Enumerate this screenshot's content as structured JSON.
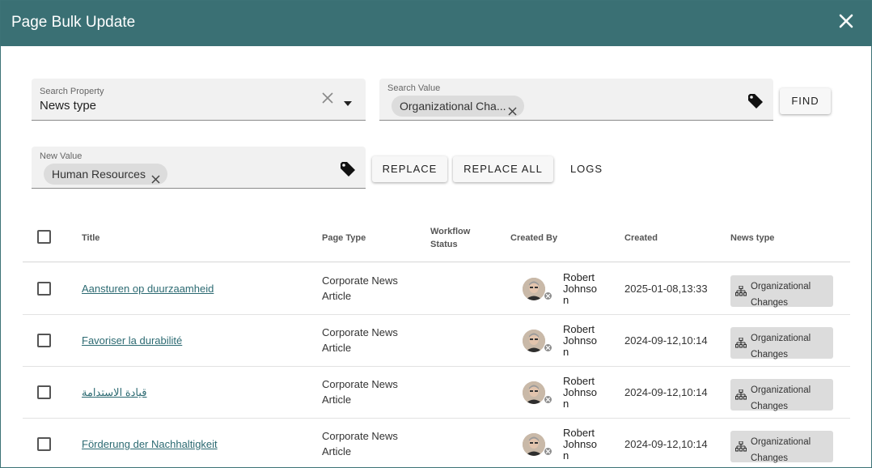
{
  "dialog": {
    "title": "Page Bulk Update",
    "close_icon": "close-icon"
  },
  "search_property": {
    "label": "Search Property",
    "value": "News type"
  },
  "search_value": {
    "label": "Search Value",
    "chip": "Organizational Cha..."
  },
  "new_value": {
    "label": "New Value",
    "chip": "Human Resources"
  },
  "buttons": {
    "find": "FIND",
    "replace": "REPLACE",
    "replace_all": "REPLACE ALL",
    "logs": "LOGS"
  },
  "table": {
    "columns": {
      "title": "Title",
      "page_type": "Page Type",
      "workflow_status": "Workflow Status",
      "created_by": "Created By",
      "created": "Created",
      "news_type": "News type"
    },
    "rows": [
      {
        "title": "Aansturen op duurzaamheid",
        "page_type": "Corporate News Article",
        "workflow_status": "",
        "created_by": "Robert Johnson",
        "created": "2025-01-08,13:33",
        "news_type": "Organizational Changes"
      },
      {
        "title": "Favoriser la durabilité",
        "page_type": "Corporate News Article",
        "workflow_status": "",
        "created_by": "Robert Johnson",
        "created": "2024-09-12,10:14",
        "news_type": "Organizational Changes"
      },
      {
        "title": "قيادة الاستدامة",
        "page_type": "Corporate News Article",
        "workflow_status": "",
        "created_by": "Robert Johnson",
        "created": "2024-09-12,10:14",
        "news_type": "Organizational Changes"
      },
      {
        "title": "Förderung der Nachhaltigkeit",
        "page_type": "Corporate News Article",
        "workflow_status": "",
        "created_by": "Robert Johnson",
        "created": "2024-09-12,10:14",
        "news_type": "Organizational Changes"
      }
    ]
  },
  "colors": {
    "header": "#3a7074",
    "link": "#2c6a72",
    "chip": "#dcdcdc"
  }
}
